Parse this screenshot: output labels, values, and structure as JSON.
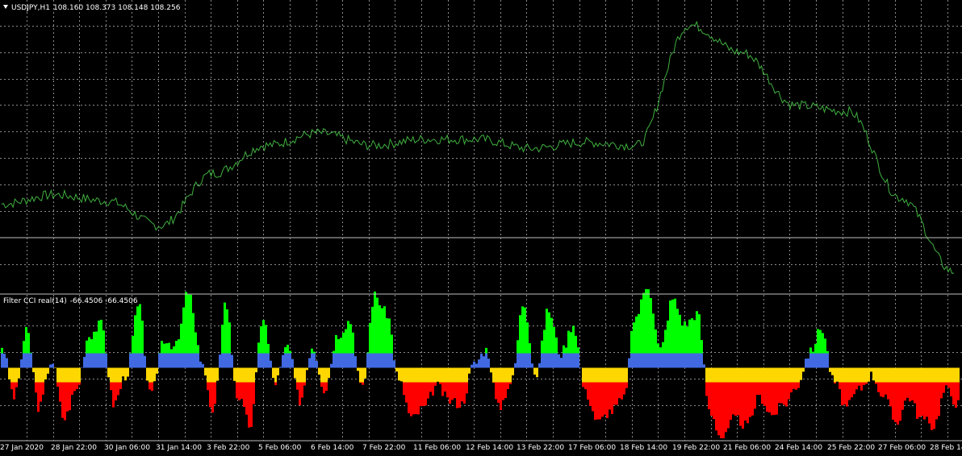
{
  "main_header": {
    "symbol": "USDJPY,H1",
    "ohlc": "108.160 108.373 108.148 108.256"
  },
  "indicator_header": {
    "name": "Filter CCI real(14)",
    "values": "-66.4506 -66.4506"
  },
  "colors": {
    "price": "#3fb03f",
    "grid": "#8a8a8a",
    "strong_up": "#00ff00",
    "up": "#4169e1",
    "down": "#ffd700",
    "strong_down": "#ff0000"
  },
  "x_labels": [
    "27 Jan 2020",
    "28 Jan 22:00",
    "30 Jan 06:00",
    "31 Jan 14:00",
    "3 Feb 22:00",
    "5 Feb 06:00",
    "6 Feb 14:00",
    "7 Feb 22:00",
    "11 Feb 06:00",
    "12 Feb 14:00",
    "13 Feb 22:00",
    "17 Feb 06:00",
    "18 Feb 14:00",
    "19 Feb 22:00",
    "21 Feb 06:00",
    "24 Feb 14:00",
    "25 Feb 22:00",
    "27 Feb 06:00",
    "28 Feb 14:00"
  ],
  "chart_data": [
    {
      "type": "line",
      "symbol": "USDJPY,H1",
      "x": [
        "27 Jan 2020",
        "28 Jan 22:00",
        "30 Jan 06:00",
        "31 Jan 14:00",
        "3 Feb 22:00",
        "5 Feb 06:00",
        "6 Feb 14:00",
        "7 Feb 22:00",
        "11 Feb 06:00",
        "12 Feb 14:00",
        "13 Feb 22:00",
        "17 Feb 06:00",
        "18 Feb 14:00",
        "19 Feb 22:00",
        "21 Feb 06:00",
        "24 Feb 14:00",
        "25 Feb 22:00",
        "27 Feb 06:00",
        "28 Feb 14:00"
      ],
      "values": [
        108.9,
        109.05,
        108.95,
        108.55,
        109.4,
        109.85,
        110.05,
        109.85,
        109.95,
        109.95,
        109.8,
        109.9,
        109.85,
        111.8,
        111.35,
        110.5,
        110.4,
        109.0,
        107.8
      ],
      "last_ohlc": {
        "open": 108.16,
        "high": 108.373,
        "low": 108.148,
        "close": 108.256
      }
    },
    {
      "type": "bar",
      "name": "Filter CCI real(14)",
      "current": [
        -66.4506,
        -66.4506
      ],
      "levels": [
        -100,
        0,
        100
      ],
      "x": [
        "27 Jan 2020",
        "28 Jan 22:00",
        "30 Jan 06:00",
        "31 Jan 14:00",
        "3 Feb 22:00",
        "5 Feb 06:00",
        "6 Feb 14:00",
        "7 Feb 22:00",
        "11 Feb 06:00",
        "12 Feb 14:00",
        "13 Feb 22:00",
        "17 Feb 06:00",
        "18 Feb 14:00",
        "19 Feb 22:00",
        "21 Feb 06:00",
        "24 Feb 14:00",
        "25 Feb 22:00",
        "27 Feb 06:00",
        "28 Feb 14:00"
      ],
      "values": [
        60,
        -80,
        100,
        -110,
        20,
        -140,
        -60,
        90,
        120,
        -100,
        -20,
        170,
        -80,
        80,
        60,
        210,
        30,
        -130,
        180,
        -80,
        -160,
        140,
        -40,
        60,
        -90,
        60,
        -60,
        90,
        130,
        -60,
        200,
        150,
        -40,
        -140,
        -110,
        -50,
        -90,
        -100,
        10,
        50,
        -110,
        -40,
        180,
        -20,
        160,
        40,
        120,
        -70,
        -150,
        -120,
        -90,
        140,
        230,
        50,
        190,
        120,
        150,
        -120,
        -200,
        -140,
        -160,
        -80,
        -130,
        -100,
        -50,
        40,
        110,
        -40,
        -110,
        -60,
        -20,
        -80,
        -150,
        -80,
        -140,
        -160,
        -60,
        -100
      ]
    }
  ]
}
